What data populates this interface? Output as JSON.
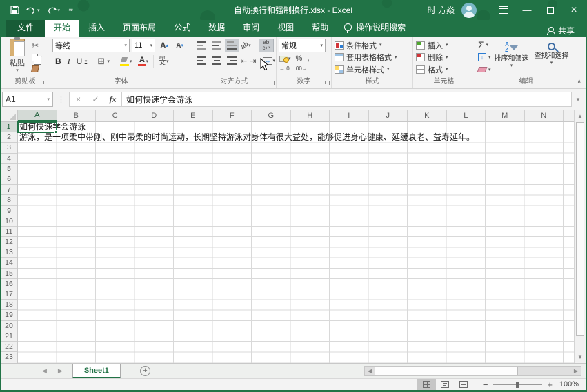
{
  "window": {
    "title": "自动换行和强制换行.xlsx - Excel",
    "user_name": "时 方焱",
    "minimize_glyph": "—",
    "close_glyph": "×"
  },
  "tabsrow": {
    "tabs": [
      "文件",
      "开始",
      "插入",
      "页面布局",
      "公式",
      "数据",
      "审阅",
      "视图",
      "帮助"
    ],
    "active_tab": "开始",
    "tellme_label": "操作说明搜索",
    "share_label": "共享"
  },
  "ribbon": {
    "clipboard": {
      "label": "剪贴板",
      "paste_label": "粘贴"
    },
    "font": {
      "label": "字体",
      "family": "等线",
      "size": "11",
      "grow": "A",
      "shrink": "A",
      "bold": "B",
      "italic": "I",
      "underline": "U",
      "border_glyph": "⊞",
      "color_letter": "A",
      "phonetic_top": "wén",
      "phonetic_bottom": "文"
    },
    "alignment": {
      "label": "对齐方式",
      "orientation_glyph": "ab",
      "wrap_top": "ab",
      "wrap_bottom": "c↩",
      "outdent_glyph": "⇤",
      "indent_glyph": "⇥",
      "merge_glyph": "↔"
    },
    "number": {
      "label": "数字",
      "format": "常规",
      "percent": "%",
      "comma": ",",
      "dec_inc": "←.0",
      "dec_dec": ".00→"
    },
    "styles": {
      "label": "样式",
      "items": [
        "条件格式",
        "套用表格格式",
        "单元格样式"
      ]
    },
    "cells": {
      "label": "单元格",
      "items": [
        "插入",
        "删除",
        "格式"
      ]
    },
    "editing": {
      "label": "编辑",
      "sum_glyph": "Σ",
      "fill_glyph": "↓",
      "sort_a": "A",
      "sort_z": "Z",
      "sort_label": "排序和筛选",
      "find_label": "查找和选择"
    }
  },
  "formula_bar": {
    "name_box": "A1",
    "cancel_glyph": "×",
    "enter_glyph": "✓",
    "fx_glyph": "fx",
    "content": "如何快速学会游泳"
  },
  "grid": {
    "columns": [
      "A",
      "B",
      "C",
      "D",
      "E",
      "F",
      "G",
      "H",
      "I",
      "J",
      "K",
      "L",
      "M",
      "N"
    ],
    "row_count": 24,
    "selected_column": "A",
    "selected_row": 1,
    "selected_cell": "A1",
    "cells": [
      {
        "row": 1,
        "col": "A",
        "text": "如何快速学会游泳"
      },
      {
        "row": 2,
        "col": "A",
        "text": "游泳，是一项柔中带刚、刚中带柔的时尚运动，长期坚持游泳对身体有很大益处，能够促进身心健康、延缓衰老、益寿延年。"
      }
    ]
  },
  "sheet_bar": {
    "active_tab": "Sheet1"
  },
  "status_bar": {
    "zoom_level": "100%"
  },
  "colors": {
    "accent": "#217346",
    "title_bar": "#217346",
    "selection_border": "#217346"
  }
}
